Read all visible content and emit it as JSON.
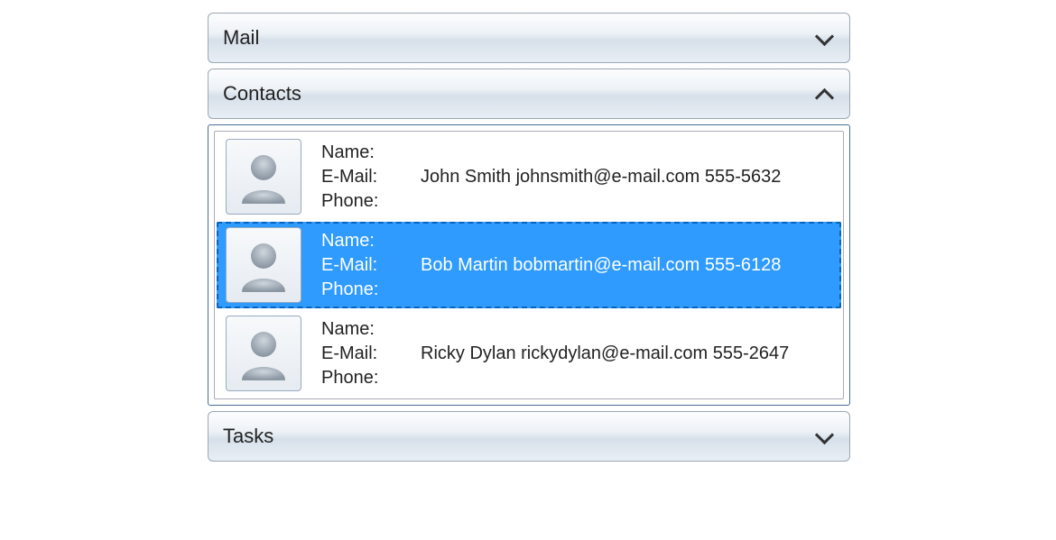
{
  "accordion": {
    "mail": {
      "title": "Mail",
      "expanded": false
    },
    "contacts": {
      "title": "Contacts",
      "expanded": true
    },
    "tasks": {
      "title": "Tasks",
      "expanded": false
    }
  },
  "labels": {
    "name": "Name:",
    "email": "E-Mail:",
    "phone": "Phone:"
  },
  "contacts": [
    {
      "name": "John Smith",
      "email": "johnsmith@e-mail.com",
      "phone": "555-5632",
      "selected": false,
      "display": "John Smith  johnsmith@e-mail.com 555-5632"
    },
    {
      "name": "Bob Martin",
      "email": "bobmartin@e-mail.com",
      "phone": "555-6128",
      "selected": true,
      "display": "Bob Martin  bobmartin@e-mail.com 555-6128"
    },
    {
      "name": "Ricky Dylan",
      "email": "rickydylan@e-mail.com",
      "phone": "555-2647",
      "selected": false,
      "display": "Ricky Dylan  rickydylan@e-mail.com 555-2647"
    }
  ]
}
